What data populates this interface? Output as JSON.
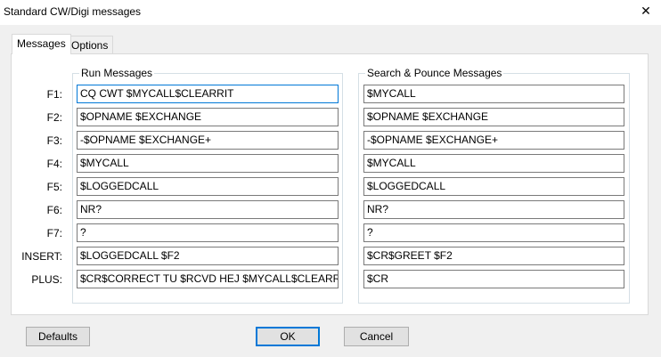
{
  "window": {
    "title": "Standard CW/Digi messages"
  },
  "tabs": [
    {
      "label": "Messages",
      "active": true
    },
    {
      "label": "Options",
      "active": false
    }
  ],
  "run_group": {
    "label": "Run Messages"
  },
  "sp_group": {
    "label": "Search & Pounce Messages"
  },
  "rows": [
    {
      "key": "F1:",
      "run": "CQ CWT $MYCALL$CLEARRIT",
      "sp": "$MYCALL"
    },
    {
      "key": "F2:",
      "run": "$OPNAME $EXCHANGE",
      "sp": "$OPNAME $EXCHANGE"
    },
    {
      "key": "F3:",
      "run": "-$OPNAME $EXCHANGE+",
      "sp": "-$OPNAME $EXCHANGE+"
    },
    {
      "key": "F4:",
      "run": "$MYCALL",
      "sp": "$MYCALL"
    },
    {
      "key": "F5:",
      "run": "$LOGGEDCALL",
      "sp": "$LOGGEDCALL"
    },
    {
      "key": "F6:",
      "run": "NR?",
      "sp": "NR?"
    },
    {
      "key": "F7:",
      "run": "?",
      "sp": "?"
    },
    {
      "key": "INSERT:",
      "run": "$LOGGEDCALL $F2",
      "sp": "$CR$GREET $F2"
    },
    {
      "key": "PLUS:",
      "run": "$CR$CORRECT TU $RCVD HEJ $MYCALL$CLEARRIT",
      "sp": "$CR"
    }
  ],
  "buttons": {
    "defaults": "Defaults",
    "ok": "OK",
    "cancel": "Cancel"
  },
  "icons": {
    "close": "close-icon"
  },
  "colors": {
    "focus_border": "#0078d7",
    "background": "#f0f0f0"
  }
}
